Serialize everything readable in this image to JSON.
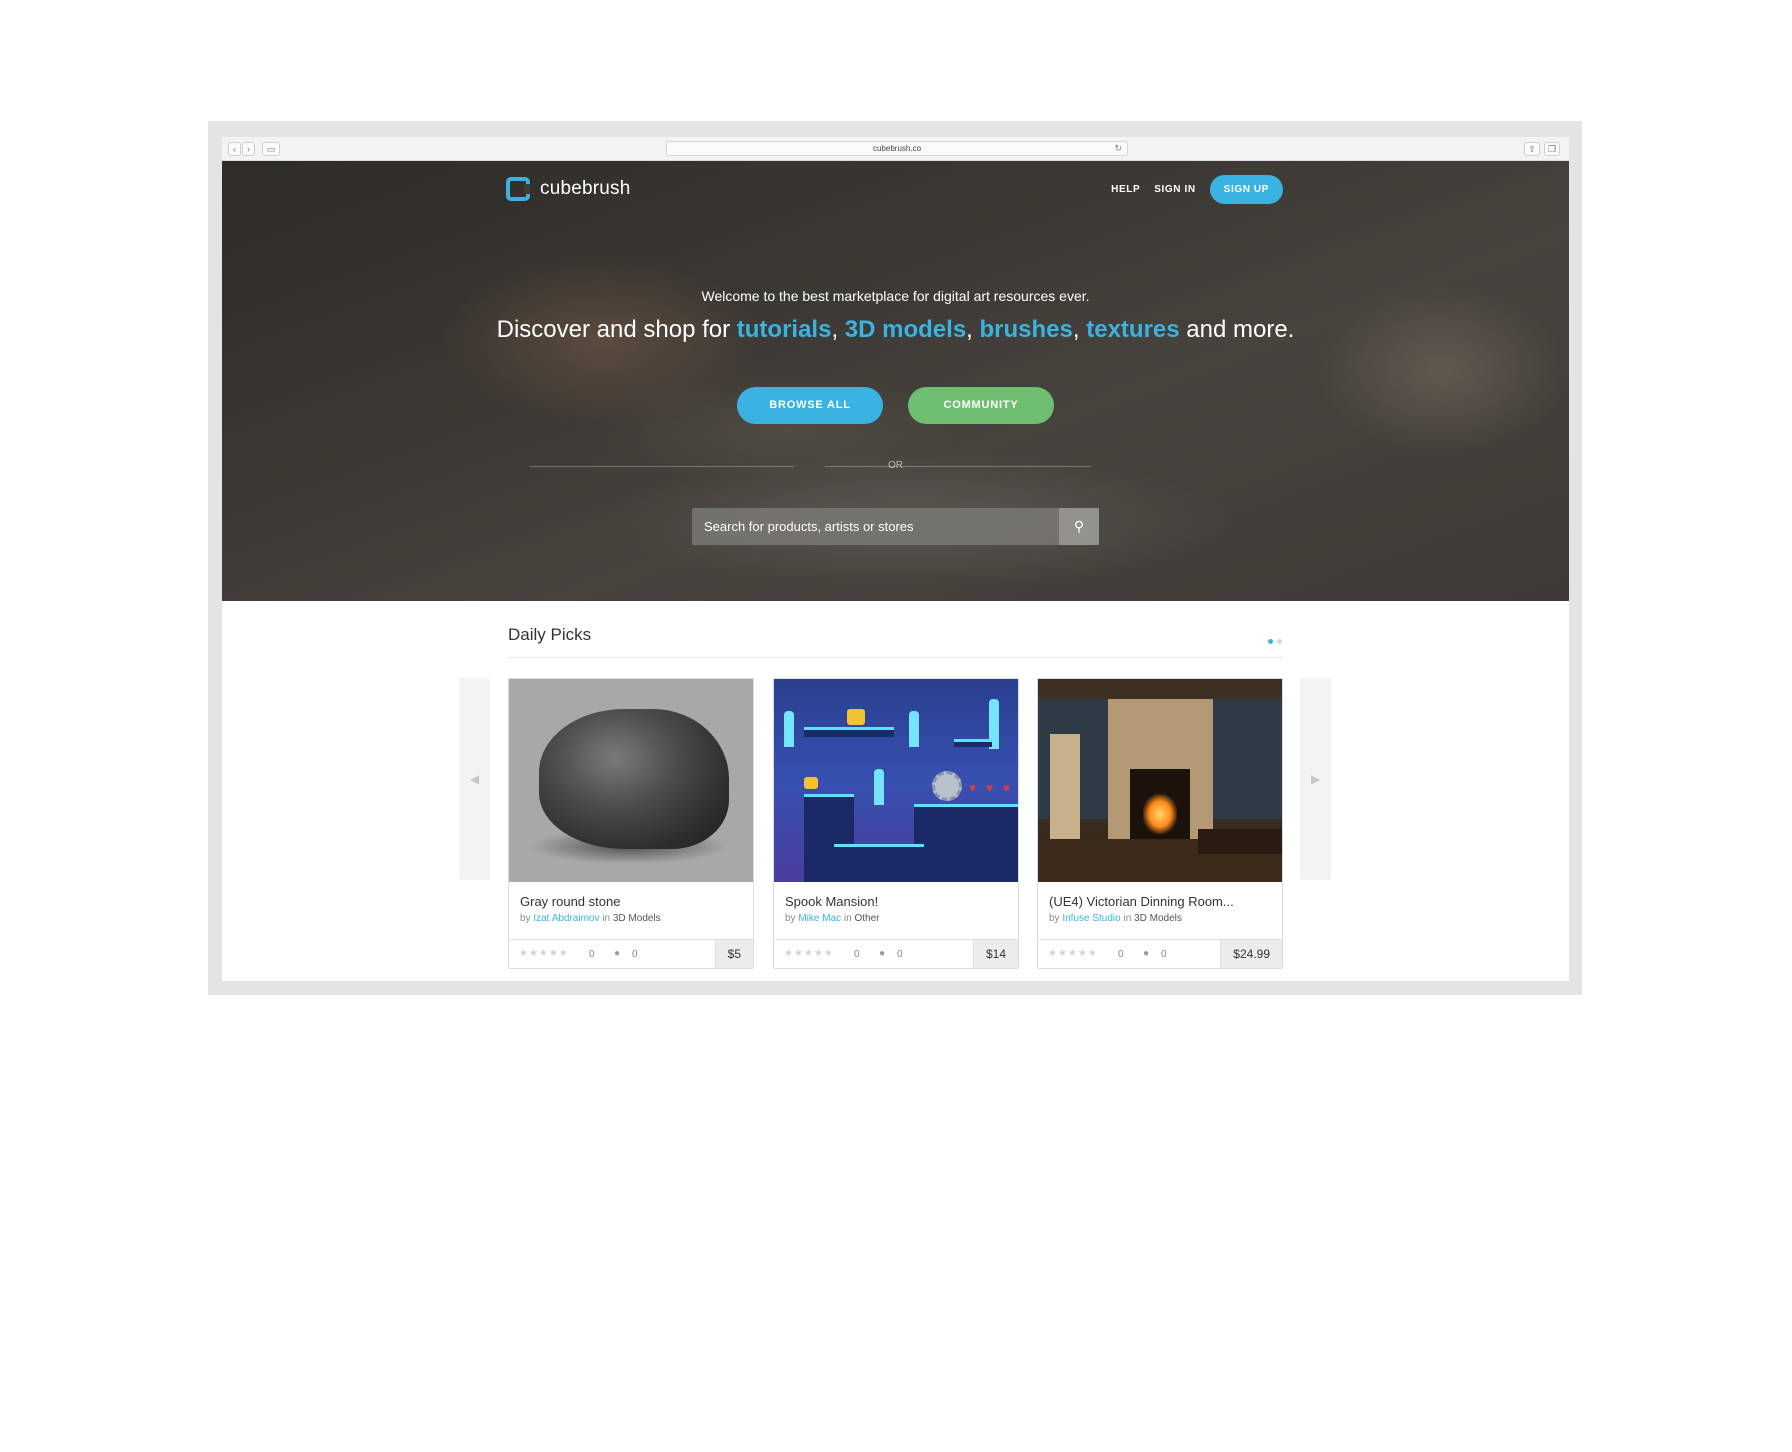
{
  "browser": {
    "url": "cubebrush.co"
  },
  "header": {
    "logo_text": "cubebrush",
    "nav": {
      "help": "HELP",
      "sign_in": "SIGN IN",
      "sign_up": "SIGN UP"
    }
  },
  "hero": {
    "welcome": "Welcome to the best marketplace for digital art resources ever.",
    "headline_prefix": "Discover and shop for ",
    "highlights": [
      "tutorials",
      "3D models",
      "brushes",
      "textures"
    ],
    "headline_suffix": " and more.",
    "browse_label": "BROWSE ALL",
    "community_label": "COMMUNITY",
    "or_label": "OR",
    "search_placeholder": "Search for products, artists or stores"
  },
  "daily_picks": {
    "title": "Daily Picks",
    "pages": 2,
    "active_page": 1,
    "cards": [
      {
        "title": "Gray round stone",
        "by": "by",
        "author": "Izat Abdraimov",
        "in": "in",
        "category": "3D Models",
        "rating": "0",
        "comments": "0",
        "price": "$5"
      },
      {
        "title": "Spook Mansion!",
        "by": "by",
        "author": "Mike Mac",
        "in": "in",
        "category": "Other",
        "rating": "0",
        "comments": "0",
        "price": "$14"
      },
      {
        "title": "(UE4) Victorian Dinning Room...",
        "by": "by",
        "author": "Infuse Studio",
        "in": "in",
        "category": "3D Models",
        "rating": "0",
        "comments": "0",
        "price": "$24.99"
      }
    ]
  },
  "colors": {
    "accent": "#3ab3e3",
    "community": "#6fbf73"
  }
}
